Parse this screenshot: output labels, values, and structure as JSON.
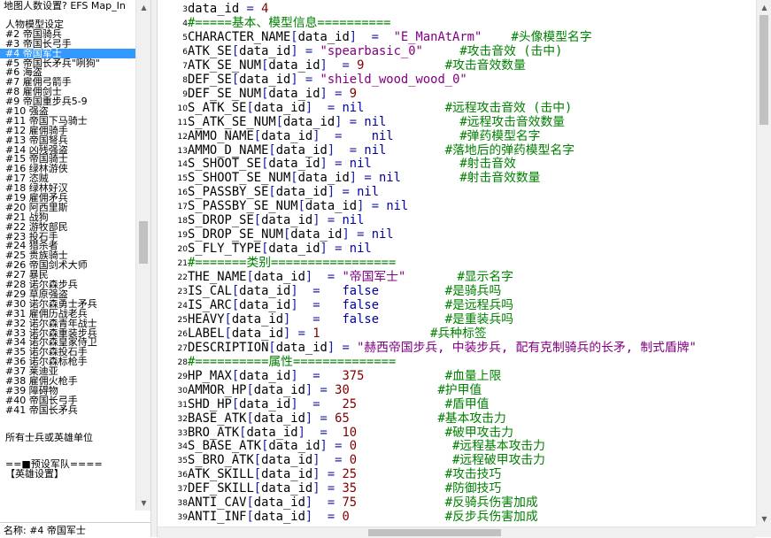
{
  "left_panel": {
    "title": "地图人数设置? EFS Map_In",
    "items": [
      {
        "text": "人物模型设定"
      },
      {
        "text": "#2 帝国骑兵"
      },
      {
        "text": "#3 帝国长弓手"
      },
      {
        "text": "#4 帝国军士",
        "selected": true
      },
      {
        "text": "#5 帝国长矛兵\"咧狗\""
      },
      {
        "text": "#6 海盗"
      },
      {
        "text": "#7 雇佣弓箭手"
      },
      {
        "text": "#8 雇佣剑士"
      },
      {
        "text": "#9 帝国重步兵5-9"
      },
      {
        "text": "#10 强盗"
      },
      {
        "text": "#11 帝国下马骑士"
      },
      {
        "text": "#12 雇佣骑手"
      },
      {
        "text": "#13 帝国弩兵"
      },
      {
        "text": "#14 凶残强盗"
      },
      {
        "text": "#15 帝国骑士"
      },
      {
        "text": "#16 绿林游侠"
      },
      {
        "text": "#17 恣贼"
      },
      {
        "text": "#18 绿林好汉"
      },
      {
        "text": "#19 雇佣矛兵"
      },
      {
        "text": "#20 阿西里斯"
      },
      {
        "text": "#21 战狗"
      },
      {
        "text": "#22 游牧部民"
      },
      {
        "text": "#23 投石手"
      },
      {
        "text": "#24 猎杀者"
      },
      {
        "text": "#25 贵族骑士"
      },
      {
        "text": "#26 帝国剑术大师"
      },
      {
        "text": "#27 暴民"
      },
      {
        "text": "#28 诺尔森步兵"
      },
      {
        "text": "#29 草原强盗"
      },
      {
        "text": "#30 诺尔森勇士矛兵"
      },
      {
        "text": "#31 雇佣历战老兵"
      },
      {
        "text": "#32 诺尔森青年战士"
      },
      {
        "text": "#33 诺尔森重装步兵"
      },
      {
        "text": "#34 诺尔森皇家侍卫"
      },
      {
        "text": "#35 诺尔森投石手"
      },
      {
        "text": "#36 诺尔森标枪手"
      },
      {
        "text": "#37 莱迪亚"
      },
      {
        "text": "#38 雇佣火枪手"
      },
      {
        "text": "#39 障碍物"
      },
      {
        "text": "#40 帝国长弓手"
      },
      {
        "text": "#41 帝国长矛兵"
      },
      {
        "text": "",
        "gap": true
      },
      {
        "text": "所有士兵或英雄单位"
      },
      {
        "text": "",
        "gap": true
      },
      {
        "text": "==■预设军队===="
      },
      {
        "text": "【英雄设置】"
      }
    ],
    "bottom_name": "名称: #4 帝国军士"
  },
  "editor": {
    "lines": [
      {
        "n": "3",
        "t": [
          [
            "i",
            "data_id"
          ],
          [
            "o",
            " = "
          ],
          [
            "n",
            "4"
          ]
        ]
      },
      {
        "n": "4",
        "t": [
          [
            "c",
            "#=====基本、模型信息=========="
          ]
        ]
      },
      {
        "n": "5",
        "t": [
          [
            "i",
            "CHARACTER_NAME"
          ],
          [
            "o",
            "["
          ],
          [
            "i",
            "data_id"
          ],
          [
            "o",
            "]  =  "
          ],
          [
            "s",
            "\"E_ManAtArm\""
          ],
          [
            "i",
            "    "
          ],
          [
            "c",
            "#头像模型名字"
          ]
        ]
      },
      {
        "n": "6",
        "t": [
          [
            "i",
            "ATK_SE"
          ],
          [
            "o",
            "["
          ],
          [
            "i",
            "data_id"
          ],
          [
            "o",
            "] = "
          ],
          [
            "s",
            "\"spearbasic_0\""
          ],
          [
            "i",
            "     "
          ],
          [
            "c",
            "#攻击音效 (击中)"
          ]
        ]
      },
      {
        "n": "7",
        "t": [
          [
            "i",
            "ATK_SE_NUM"
          ],
          [
            "o",
            "["
          ],
          [
            "i",
            "data_id"
          ],
          [
            "o",
            "]  = "
          ],
          [
            "n",
            "9"
          ],
          [
            "i",
            "           "
          ],
          [
            "c",
            "#攻击音效数量"
          ]
        ]
      },
      {
        "n": "8",
        "t": [
          [
            "i",
            "DEF_SE"
          ],
          [
            "o",
            "["
          ],
          [
            "i",
            "data_id"
          ],
          [
            "o",
            "] = "
          ],
          [
            "s",
            "\"shield_wood_wood_0\""
          ]
        ]
      },
      {
        "n": "9",
        "t": [
          [
            "i",
            "DEF_SE_NUM"
          ],
          [
            "o",
            "["
          ],
          [
            "i",
            "data_id"
          ],
          [
            "o",
            "] = "
          ],
          [
            "n",
            "9"
          ]
        ]
      },
      {
        "n": "10",
        "t": [
          [
            "i",
            "S_ATK_SE"
          ],
          [
            "o",
            "["
          ],
          [
            "i",
            "data_id"
          ],
          [
            "o",
            "]  = "
          ],
          [
            "k",
            "nil"
          ],
          [
            "i",
            "           "
          ],
          [
            "c",
            "#远程攻击音效 (击中)"
          ]
        ]
      },
      {
        "n": "11",
        "t": [
          [
            "i",
            "S_ATK_SE_NUM"
          ],
          [
            "o",
            "["
          ],
          [
            "i",
            "data_id"
          ],
          [
            "o",
            "] = "
          ],
          [
            "k",
            "nil"
          ],
          [
            "i",
            "          "
          ],
          [
            "c",
            "#远程攻击音效数量"
          ]
        ]
      },
      {
        "n": "12",
        "t": [
          [
            "i",
            "AMMO_NAME"
          ],
          [
            "o",
            "["
          ],
          [
            "i",
            "data_id"
          ],
          [
            "o",
            "]  =    "
          ],
          [
            "k",
            "nil"
          ],
          [
            "i",
            "         "
          ],
          [
            "c",
            "#弹药模型名字"
          ]
        ]
      },
      {
        "n": "13",
        "t": [
          [
            "i",
            "AMMO_D_NAME"
          ],
          [
            "o",
            "["
          ],
          [
            "i",
            "data_id"
          ],
          [
            "o",
            "]  = "
          ],
          [
            "k",
            "nil"
          ],
          [
            "i",
            "        "
          ],
          [
            "c",
            "#落地后的弹药模型名字"
          ]
        ]
      },
      {
        "n": "14",
        "t": [
          [
            "i",
            "S_SHOOT_SE"
          ],
          [
            "o",
            "["
          ],
          [
            "i",
            "data_id"
          ],
          [
            "o",
            "] = "
          ],
          [
            "k",
            "nil"
          ],
          [
            "i",
            "            "
          ],
          [
            "c",
            "#射击音效"
          ]
        ]
      },
      {
        "n": "15",
        "t": [
          [
            "i",
            "S_SHOOT_SE_NUM"
          ],
          [
            "o",
            "["
          ],
          [
            "i",
            "data_id"
          ],
          [
            "o",
            "] = "
          ],
          [
            "k",
            "nil"
          ],
          [
            "i",
            "        "
          ],
          [
            "c",
            "#射击音效数量"
          ]
        ]
      },
      {
        "n": "16",
        "t": [
          [
            "i",
            "S_PASSBY_SE"
          ],
          [
            "o",
            "["
          ],
          [
            "i",
            "data_id"
          ],
          [
            "o",
            "] = "
          ],
          [
            "k",
            "nil"
          ]
        ]
      },
      {
        "n": "17",
        "t": [
          [
            "i",
            "S_PASSBY_SE_NUM"
          ],
          [
            "o",
            "["
          ],
          [
            "i",
            "data_id"
          ],
          [
            "o",
            "] = "
          ],
          [
            "k",
            "nil"
          ]
        ]
      },
      {
        "n": "18",
        "t": [
          [
            "i",
            "S_DROP_SE"
          ],
          [
            "o",
            "["
          ],
          [
            "i",
            "data_id"
          ],
          [
            "o",
            "] = "
          ],
          [
            "k",
            "nil"
          ]
        ]
      },
      {
        "n": "19",
        "t": [
          [
            "i",
            "S_DROP_SE_NUM"
          ],
          [
            "o",
            "["
          ],
          [
            "i",
            "data_id"
          ],
          [
            "o",
            "] = "
          ],
          [
            "k",
            "nil"
          ]
        ]
      },
      {
        "n": "20",
        "t": [
          [
            "i",
            "S_FLY_TYPE"
          ],
          [
            "o",
            "["
          ],
          [
            "i",
            "data_id"
          ],
          [
            "o",
            "] = "
          ],
          [
            "k",
            "nil"
          ]
        ]
      },
      {
        "n": "21",
        "t": [
          [
            "c",
            "#=======类别================="
          ]
        ]
      },
      {
        "n": "22",
        "t": [
          [
            "i",
            "THE_NAME"
          ],
          [
            "o",
            "["
          ],
          [
            "i",
            "data_id"
          ],
          [
            "o",
            "]  = "
          ],
          [
            "s",
            "\"帝国军士\""
          ],
          [
            "i",
            "       "
          ],
          [
            "c",
            "#显示名字"
          ]
        ]
      },
      {
        "n": "23",
        "t": [
          [
            "i",
            "IS_CAL"
          ],
          [
            "o",
            "["
          ],
          [
            "i",
            "data_id"
          ],
          [
            "o",
            "]  =   "
          ],
          [
            "k",
            "false"
          ],
          [
            "i",
            "         "
          ],
          [
            "c",
            "#是骑兵吗"
          ]
        ]
      },
      {
        "n": "24",
        "t": [
          [
            "i",
            "IS_ARC"
          ],
          [
            "o",
            "["
          ],
          [
            "i",
            "data_id"
          ],
          [
            "o",
            "]  =   "
          ],
          [
            "k",
            "false"
          ],
          [
            "i",
            "         "
          ],
          [
            "c",
            "#是远程兵吗"
          ]
        ]
      },
      {
        "n": "25",
        "t": [
          [
            "i",
            "HEAVY"
          ],
          [
            "o",
            "["
          ],
          [
            "i",
            "data_id"
          ],
          [
            "o",
            "]   =   "
          ],
          [
            "k",
            "false"
          ],
          [
            "i",
            "         "
          ],
          [
            "c",
            "#是重装兵吗"
          ]
        ]
      },
      {
        "n": "26",
        "t": [
          [
            "i",
            "LABEL"
          ],
          [
            "o",
            "["
          ],
          [
            "i",
            "data_id"
          ],
          [
            "o",
            "] = "
          ],
          [
            "n",
            "1"
          ],
          [
            "i",
            "               "
          ],
          [
            "c",
            "#兵种标签"
          ]
        ]
      },
      {
        "n": "27",
        "t": [
          [
            "i",
            "DESCRIPTION"
          ],
          [
            "o",
            "["
          ],
          [
            "i",
            "data_id"
          ],
          [
            "o",
            "] = "
          ],
          [
            "s",
            "\"赫西帝国步兵, 中装步兵, 配有克制骑兵的长矛, 制式盾牌\""
          ]
        ]
      },
      {
        "n": "28",
        "t": [
          [
            "c",
            "#==========属性=============="
          ]
        ]
      },
      {
        "n": "29",
        "t": [
          [
            "i",
            "HP_MAX"
          ],
          [
            "o",
            "["
          ],
          [
            "i",
            "data_id"
          ],
          [
            "o",
            "]  =   "
          ],
          [
            "n",
            "375"
          ],
          [
            "i",
            "           "
          ],
          [
            "c",
            "#血量上限"
          ]
        ]
      },
      {
        "n": "30",
        "t": [
          [
            "i",
            "AMMOR_HP"
          ],
          [
            "o",
            "["
          ],
          [
            "i",
            "data_id"
          ],
          [
            "o",
            "] = "
          ],
          [
            "n",
            "30"
          ],
          [
            "i",
            "            "
          ],
          [
            "c",
            "#护甲值"
          ]
        ]
      },
      {
        "n": "31",
        "t": [
          [
            "i",
            "SHD_HP"
          ],
          [
            "o",
            "["
          ],
          [
            "i",
            "data_id"
          ],
          [
            "o",
            "]  =   "
          ],
          [
            "n",
            "25"
          ],
          [
            "i",
            "            "
          ],
          [
            "c",
            "#盾甲值"
          ]
        ]
      },
      {
        "n": "32",
        "t": [
          [
            "i",
            "BASE_ATK"
          ],
          [
            "o",
            "["
          ],
          [
            "i",
            "data_id"
          ],
          [
            "o",
            "] = "
          ],
          [
            "n",
            "65"
          ],
          [
            "i",
            "            "
          ],
          [
            "c",
            "#基本攻击力"
          ]
        ]
      },
      {
        "n": "33",
        "t": [
          [
            "i",
            "BRO_ATK"
          ],
          [
            "o",
            "["
          ],
          [
            "i",
            "data_id"
          ],
          [
            "o",
            "]  =  "
          ],
          [
            "n",
            "10"
          ],
          [
            "i",
            "            "
          ],
          [
            "c",
            "#破甲攻击力"
          ]
        ]
      },
      {
        "n": "34",
        "t": [
          [
            "i",
            "S_BASE_ATK"
          ],
          [
            "o",
            "["
          ],
          [
            "i",
            "data_id"
          ],
          [
            "o",
            "] = "
          ],
          [
            "n",
            "0"
          ],
          [
            "i",
            "             "
          ],
          [
            "c",
            "#远程基本攻击力"
          ]
        ]
      },
      {
        "n": "35",
        "t": [
          [
            "i",
            "S_BRO_ATK"
          ],
          [
            "o",
            "["
          ],
          [
            "i",
            "data_id"
          ],
          [
            "o",
            "]  = "
          ],
          [
            "n",
            "0"
          ],
          [
            "i",
            "             "
          ],
          [
            "c",
            "#远程破甲攻击力"
          ]
        ]
      },
      {
        "n": "36",
        "t": [
          [
            "i",
            "ATK_SKILL"
          ],
          [
            "o",
            "["
          ],
          [
            "i",
            "data_id"
          ],
          [
            "o",
            "] = "
          ],
          [
            "n",
            "25"
          ],
          [
            "i",
            "            "
          ],
          [
            "c",
            "#攻击技巧"
          ]
        ]
      },
      {
        "n": "37",
        "t": [
          [
            "i",
            "DEF_SKILL"
          ],
          [
            "o",
            "["
          ],
          [
            "i",
            "data_id"
          ],
          [
            "o",
            "] = "
          ],
          [
            "n",
            "35"
          ],
          [
            "i",
            "            "
          ],
          [
            "c",
            "#防御技巧"
          ]
        ]
      },
      {
        "n": "38",
        "t": [
          [
            "i",
            "ANTI_CAV"
          ],
          [
            "o",
            "["
          ],
          [
            "i",
            "data_id"
          ],
          [
            "o",
            "]  = "
          ],
          [
            "n",
            "75"
          ],
          [
            "i",
            "            "
          ],
          [
            "c",
            "#反骑兵伤害加成"
          ]
        ]
      },
      {
        "n": "39",
        "t": [
          [
            "i",
            "ANTI_INF"
          ],
          [
            "o",
            "["
          ],
          [
            "i",
            "data_id"
          ],
          [
            "o",
            "]  = "
          ],
          [
            "n",
            "0"
          ],
          [
            "i",
            "             "
          ],
          [
            "c",
            "#反步兵伤害加成"
          ]
        ]
      }
    ]
  },
  "scroll": {
    "left_position": 0.47,
    "right_position": 0.0,
    "horizontal_position": 0.45
  },
  "colors": {
    "selection": "#3399ff",
    "comment": "#008000",
    "string": "#800080",
    "keyword": "#0000a0",
    "number": "#800000"
  }
}
